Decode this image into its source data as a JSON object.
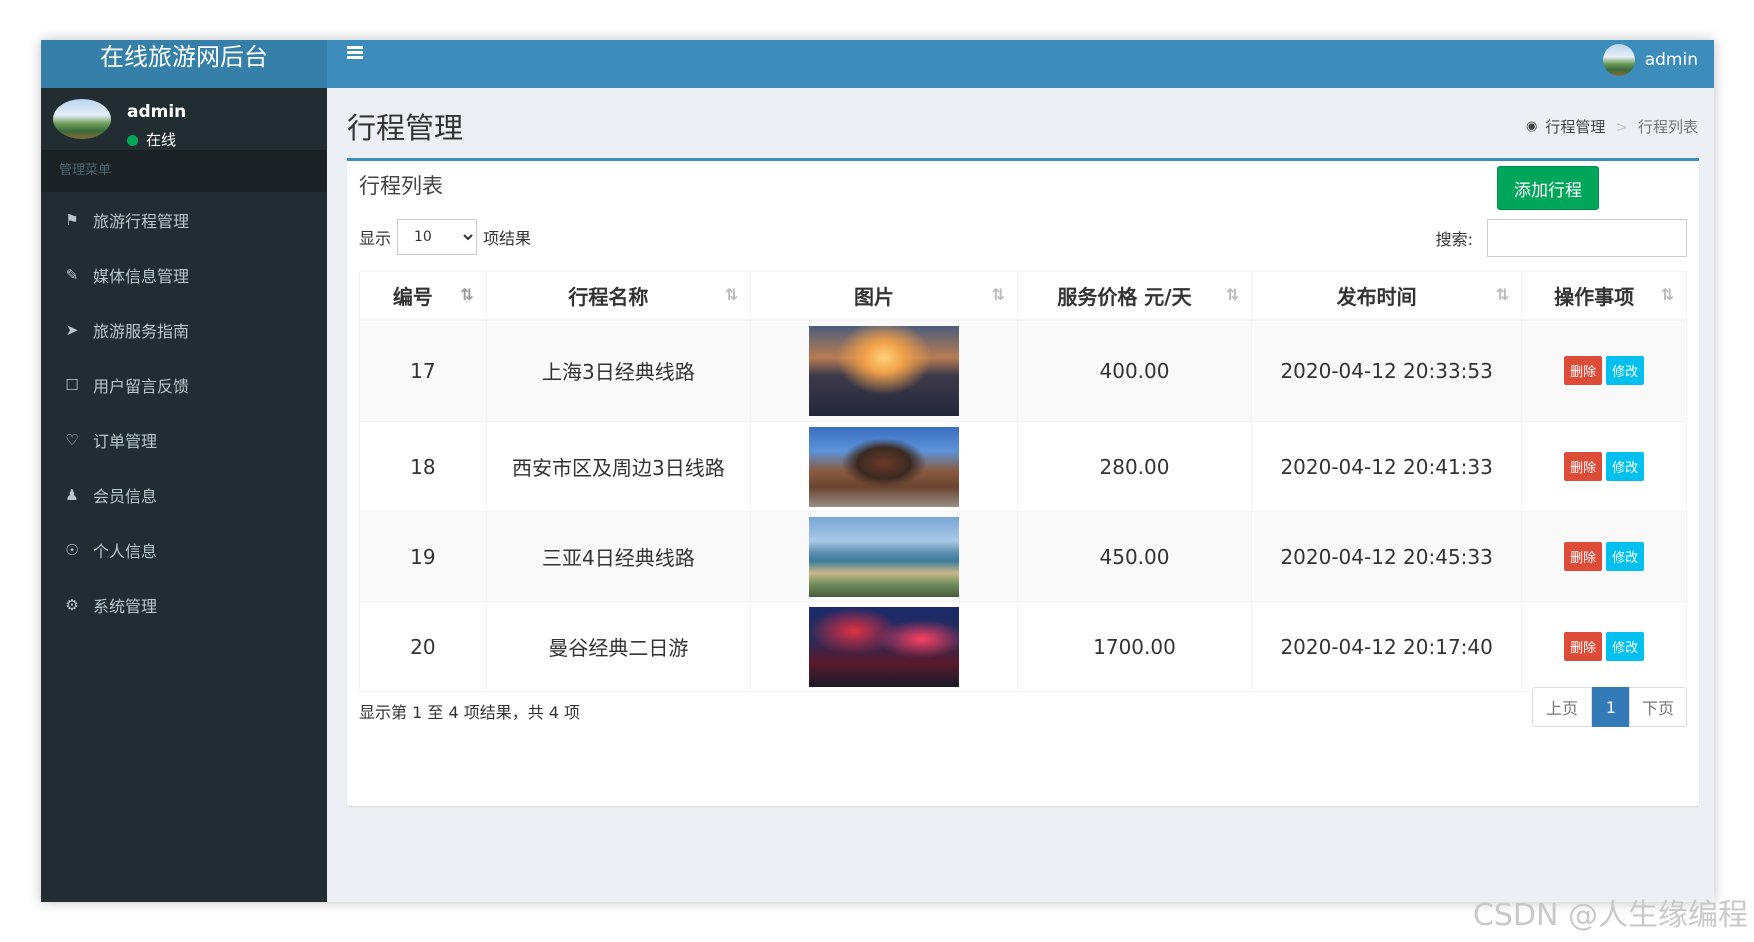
{
  "sidebar": {
    "logo": "在线旅游网后台",
    "user_name": "admin",
    "user_status": "在线",
    "menu_header": "管理菜单",
    "items": [
      {
        "label": "旅游行程管理",
        "icon": "tag-icon"
      },
      {
        "label": "媒体信息管理",
        "icon": "pencil-icon"
      },
      {
        "label": "旅游服务指南",
        "icon": "paper-plane-icon"
      },
      {
        "label": "用户留言反馈",
        "icon": "bookmark-icon"
      },
      {
        "label": "订单管理",
        "icon": "heart-icon"
      },
      {
        "label": "会员信息",
        "icon": "user-icon"
      },
      {
        "label": "个人信息",
        "icon": "user-circle-icon"
      },
      {
        "label": "系统管理",
        "icon": "gear-icon"
      }
    ]
  },
  "topbar": {
    "user_name": "admin"
  },
  "page": {
    "title": "行程管理",
    "breadcrumb": [
      "行程管理",
      "行程列表"
    ]
  },
  "box": {
    "title": "行程列表",
    "add_button": "添加行程",
    "length_prefix": "显示",
    "length_value": "10",
    "length_suffix": "项结果",
    "search_label": "搜索:",
    "search_value": ""
  },
  "table": {
    "columns": [
      "编号",
      "行程名称",
      "图片",
      "服务价格 元/天",
      "发布时间",
      "操作事项"
    ],
    "rows": [
      {
        "id": "17",
        "name": "上海3日经典线路",
        "image": "shanghai-sunset",
        "price": "400.00",
        "time": "2020-04-12 20:33:53",
        "delete": "删除",
        "edit": "修改"
      },
      {
        "id": "18",
        "name": "西安市区及周边3日线路",
        "image": "xian-drum-tower",
        "price": "280.00",
        "time": "2020-04-12 20:41:33",
        "delete": "删除",
        "edit": "修改"
      },
      {
        "id": "19",
        "name": "三亚4日经典线路",
        "image": "sanya-bay",
        "price": "450.00",
        "time": "2020-04-12 20:45:33",
        "delete": "删除",
        "edit": "修改"
      },
      {
        "id": "20",
        "name": "曼谷经典二日游",
        "image": "bangkok-night-street",
        "price": "1700.00",
        "time": "2020-04-12 20:17:40",
        "delete": "删除",
        "edit": "修改"
      }
    ]
  },
  "footer": {
    "info": "显示第 1 至 4 项结果，共 4 项",
    "prev": "上页",
    "current": "1",
    "next": "下页"
  },
  "watermark": "CSDN @人生缘编程",
  "colors": {
    "sidebar_bg": "#222d32",
    "topbar_bg": "#3c8dbc",
    "logo_bg": "#367fa9",
    "add_button": "#00a65a",
    "delete_button": "#dd4b39",
    "edit_button": "#00c0ef",
    "pager_active": "#337ab7"
  }
}
